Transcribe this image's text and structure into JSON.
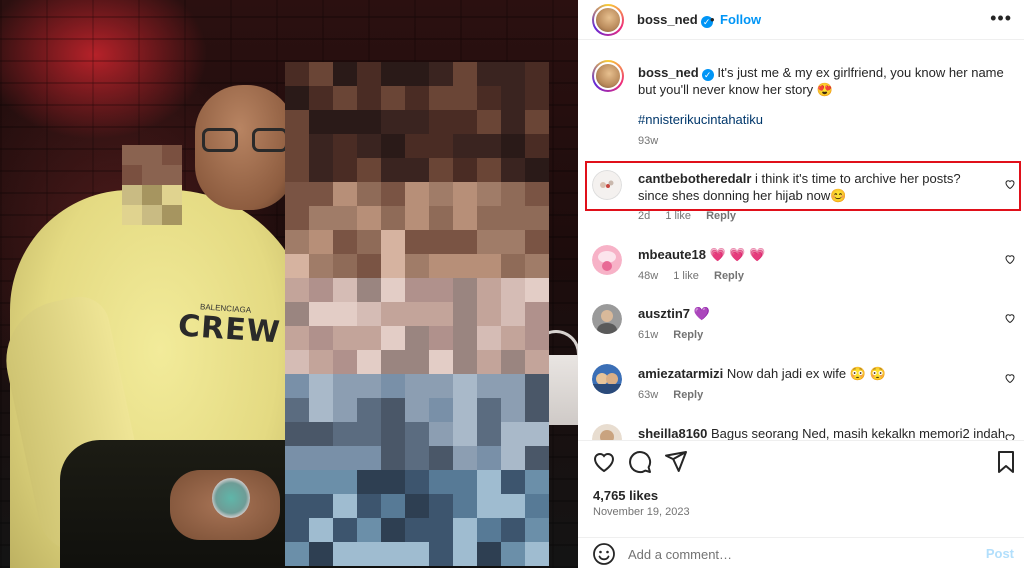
{
  "post": {
    "author": "boss_ned",
    "follow_label": "Follow",
    "separator": "•",
    "more_icon": "more-horizontal-icon",
    "verified_mark": "✓"
  },
  "caption": {
    "username": "boss_ned",
    "text": "It's just me & my ex girlfriend, you know her name but you'll never know her story 😍",
    "hashtag": "#nnisterikucintahatiku",
    "time": "93w"
  },
  "comments": [
    {
      "username": "cantbebotheredalr",
      "text": "i think it's time to archive her posts? since shes donning her hijab now😊",
      "time": "2d",
      "likes": "1 like",
      "reply": "Reply",
      "highlighted": true
    },
    {
      "username": "mbeaute18",
      "text": "💗 💗 💗",
      "time": "48w",
      "likes": "1 like",
      "reply": "Reply"
    },
    {
      "username": "ausztin7",
      "text": "💜",
      "time": "61w",
      "likes": "",
      "reply": "Reply"
    },
    {
      "username": "amiezatarmizi",
      "text": "Now dah jadi ex wife 😳 😳",
      "time": "63w",
      "likes": "",
      "reply": "Reply"
    },
    {
      "username": "sheilla8160",
      "text": "Bagus seorang Ned, masih kekalkn memori2 indah",
      "time": "",
      "likes": "",
      "reply": ""
    }
  ],
  "actions": {
    "likes": "4,765 likes",
    "date": "November 19, 2023",
    "comment_placeholder": "Add a comment…",
    "post_label": "Post"
  },
  "colors": {
    "accent": "#0095f6",
    "hashtag": "#00376b",
    "highlight_border": "#e0101a",
    "muted": "#737373"
  }
}
